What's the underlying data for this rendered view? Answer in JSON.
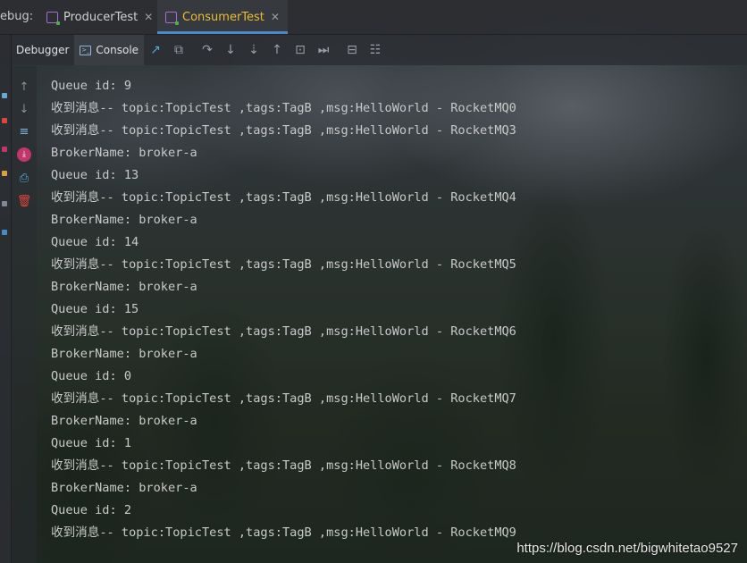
{
  "debug_label": "ebug:",
  "tabs": [
    {
      "label": "ProducerTest",
      "active": false
    },
    {
      "label": "ConsumerTest",
      "active": true
    }
  ],
  "toolbar": {
    "debugger_label": "Debugger",
    "console_label": "Console"
  },
  "console_lines": [
    "Queue id: 9",
    "收到消息-- topic:TopicTest ,tags:TagB ,msg:HelloWorld - RocketMQ0",
    "收到消息-- topic:TopicTest ,tags:TagB ,msg:HelloWorld - RocketMQ3",
    "BrokerName: broker-a",
    "Queue id: 13",
    "收到消息-- topic:TopicTest ,tags:TagB ,msg:HelloWorld - RocketMQ4",
    "BrokerName: broker-a",
    "Queue id: 14",
    "收到消息-- topic:TopicTest ,tags:TagB ,msg:HelloWorld - RocketMQ5",
    "BrokerName: broker-a",
    "Queue id: 15",
    "收到消息-- topic:TopicTest ,tags:TagB ,msg:HelloWorld - RocketMQ6",
    "BrokerName: broker-a",
    "Queue id: 0",
    "收到消息-- topic:TopicTest ,tags:TagB ,msg:HelloWorld - RocketMQ7",
    "BrokerName: broker-a",
    "Queue id: 1",
    "收到消息-- topic:TopicTest ,tags:TagB ,msg:HelloWorld - RocketMQ8",
    "BrokerName: broker-a",
    "Queue id: 2",
    "收到消息-- topic:TopicTest ,tags:TagB ,msg:HelloWorld - RocketMQ9"
  ],
  "watermark": "https://blog.csdn.net/bigwhitetao9527",
  "colors": {
    "active_tab_text": "#e8bd35",
    "tab_underline": "#4a88c7",
    "console_text": "#c9c9c9"
  }
}
